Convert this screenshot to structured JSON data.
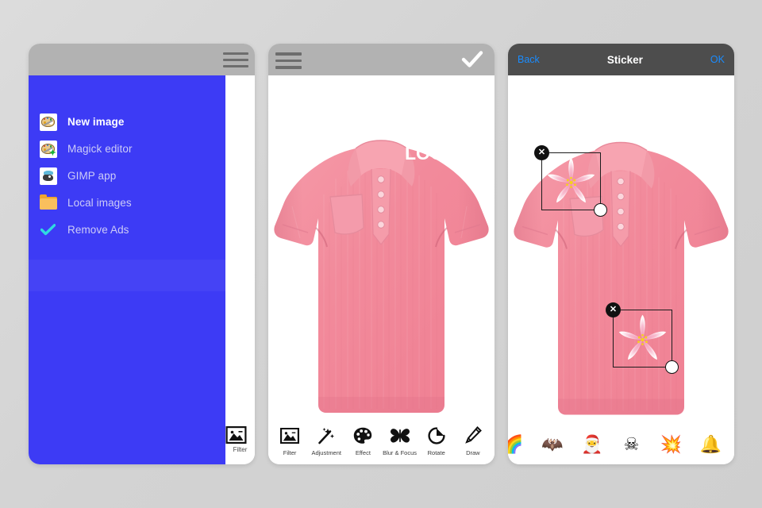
{
  "background_color": "#d4d4d4",
  "panels": {
    "drawer_panel": {
      "name": "Drawer menu screen",
      "topbar_color": "#b2b2b2",
      "drawer_color": "#3d3bf5",
      "hamburger_icon": "hamburger-icon",
      "menu_items": [
        {
          "label": "New image",
          "icon": "palette-icon",
          "active": true
        },
        {
          "label": "Magick editor",
          "icon": "palette-plus-icon",
          "active": false
        },
        {
          "label": "GIMP app",
          "icon": "gimp-wilber-icon",
          "active": false
        },
        {
          "label": "Local images",
          "icon": "folder-icon",
          "active": false
        },
        {
          "label": "Remove Ads",
          "icon": "checkmark-icon",
          "active": false
        }
      ],
      "edge_tool": {
        "label": "Filter",
        "icon": "image-icon"
      }
    },
    "editor_panel": {
      "name": "Editor screen",
      "topbar_color": "#b2b2b2",
      "hamburger_icon": "hamburger-icon",
      "confirm_icon": "checkmark-icon",
      "shirt_logo_text": "LOGO",
      "shirt_color": "#f4899a",
      "tools": [
        {
          "label": "Filter",
          "icon": "image-icon"
        },
        {
          "label": "Adjustment",
          "icon": "magic-wand-icon"
        },
        {
          "label": "Effect",
          "icon": "palette-icon"
        },
        {
          "label": "Blur & Focus",
          "icon": "butterfly-icon"
        },
        {
          "label": "Rotate",
          "icon": "rotate-icon"
        },
        {
          "label": "Draw",
          "icon": "pencil-icon"
        }
      ]
    },
    "sticker_panel": {
      "name": "Sticker screen",
      "topbar_color": "#4d4d4d",
      "accent_color": "#1a8cff",
      "back_label": "Back",
      "title": "Sticker",
      "ok_label": "OK",
      "placed_stickers": [
        {
          "name": "cherry-blossom-sticker",
          "close_icon": "close-icon",
          "resize_icon": "resize-handle-icon"
        },
        {
          "name": "cherry-blossom-sticker",
          "close_icon": "close-icon",
          "resize_icon": "resize-handle-icon"
        }
      ],
      "sticker_tray": [
        {
          "name": "rainbow-sticker",
          "glyph": "🌈"
        },
        {
          "name": "bat-sticker",
          "glyph": "🦇"
        },
        {
          "name": "holly-sticker",
          "glyph": "🎅"
        },
        {
          "name": "grim-reaper-sticker",
          "glyph": "☠"
        },
        {
          "name": "pink-sparkle-sticker",
          "glyph": "💥"
        },
        {
          "name": "bell-sticker",
          "glyph": "🔔"
        }
      ]
    }
  }
}
